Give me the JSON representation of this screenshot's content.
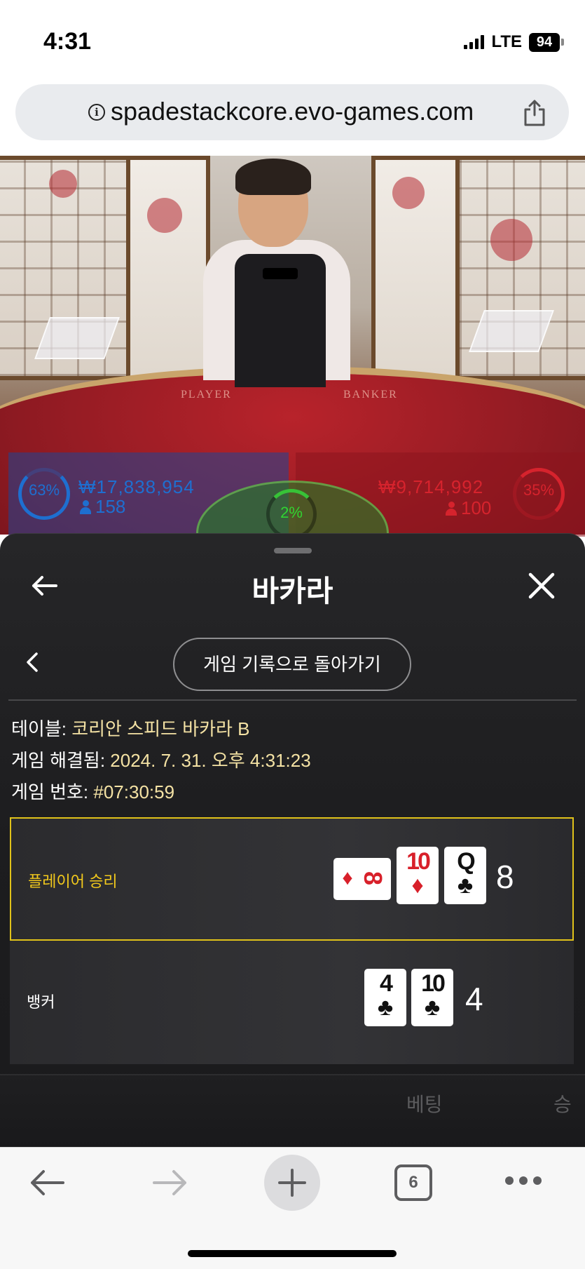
{
  "status_bar": {
    "time": "4:31",
    "network": "LTE",
    "battery": "94"
  },
  "browser": {
    "url": "spadestackcore.evo-games.com",
    "tab_count": "6"
  },
  "video": {
    "felt_left_label": "PLAYER",
    "felt_right_label": "BANKER"
  },
  "bet_stats": {
    "player": {
      "percent": "63%",
      "amount": "₩17,838,954",
      "count": "158",
      "color": "#1e6fd0"
    },
    "banker": {
      "percent": "35%",
      "amount": "₩9,714,992",
      "count": "100",
      "color": "#d6232d"
    },
    "tie": {
      "percent": "2%",
      "color": "#31d431"
    }
  },
  "sheet": {
    "title": "바카라",
    "back_history_label": "게임 기록으로 돌아가기",
    "info": {
      "table_label": "테이블:",
      "table_value": "코리안 스피드 바카라 B",
      "resolved_label": "게임 해결됨:",
      "resolved_value": "2024. 7. 31. 오후 4:31:23",
      "game_no_label": "게임 번호:",
      "game_no_value": "#07:30:59"
    },
    "results": [
      {
        "label": "플레이어 승리",
        "winner": true,
        "label_color": "#f2c91c",
        "cards": [
          {
            "rank": "8",
            "suit": "♦",
            "color": "red",
            "sideways": true
          },
          {
            "rank": "10",
            "suit": "♦",
            "color": "red",
            "sideways": false
          },
          {
            "rank": "Q",
            "suit": "♣",
            "color": "black",
            "sideways": false
          }
        ],
        "score": "8"
      },
      {
        "label": "뱅커",
        "winner": false,
        "label_color": "#ffffff",
        "cards": [
          {
            "rank": "4",
            "suit": "♣",
            "color": "black",
            "sideways": false
          },
          {
            "rank": "10",
            "suit": "♣",
            "color": "black",
            "sideways": false
          }
        ],
        "score": "4"
      }
    ],
    "bet_columns": {
      "bet": "베팅",
      "win": "승"
    }
  }
}
